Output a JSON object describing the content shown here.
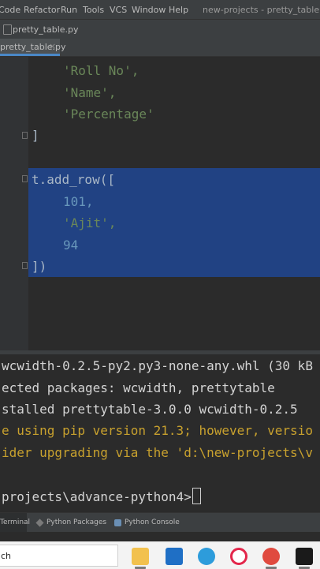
{
  "menu": {
    "items": [
      "Code",
      "Refactor",
      "Run",
      "Tools",
      "VCS",
      "Window",
      "Help"
    ],
    "window_title": "new-projects - pretty_table.py"
  },
  "nav": {
    "file": "pretty_table.py"
  },
  "tab": {
    "label": "pretty_table.py",
    "close": "×"
  },
  "editor": {
    "line1": "'Roll No',",
    "line2": "'Name',",
    "line3": "'Percentage'",
    "line4": "]",
    "line5": "t.add_row([",
    "line6_value": "101,",
    "line7_value": "'Ajit',",
    "line8_value": "94",
    "line9": "])"
  },
  "terminal": {
    "l1": "wcwidth-0.2.5-py2.py3-none-any.whl (30 kB",
    "l2": "ected packages: wcwidth, prettytable",
    "l3": "stalled prettytable-3.0.0 wcwidth-0.2.5",
    "l4": "e using pip version 21.3; however, versio",
    "l5": "ider upgrading via the 'd:\\new-projects\\v",
    "prompt": "projects\\advance-python4>"
  },
  "tool_windows": {
    "terminal": "Terminal",
    "python_packages": "Python Packages",
    "python_console": "Python Console"
  },
  "taskbar": {
    "search": "ch",
    "apps": [
      "file-explorer",
      "mail",
      "edge",
      "opera",
      "chrome",
      "pycharm"
    ]
  },
  "colors": {
    "editor_bg": "#2b2b2b",
    "selection": "#214283",
    "string": "#6a8759",
    "number": "#6897bb",
    "warning": "#c8a12e"
  }
}
